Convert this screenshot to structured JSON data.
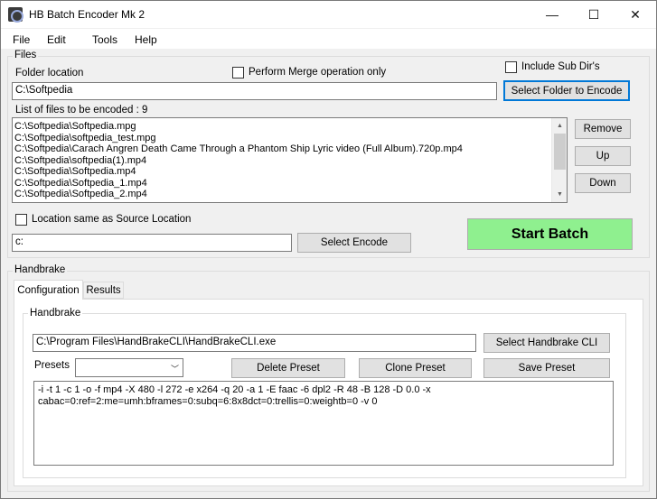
{
  "window": {
    "title": "HB Batch Encoder Mk 2",
    "controls": {
      "minimize": "—",
      "maximize": "☐",
      "close": "✕"
    }
  },
  "menu": [
    "File",
    "Edit",
    "Tools",
    "Help"
  ],
  "files": {
    "group_label": "Files",
    "folder_location_label": "Folder location",
    "merge_label": "Perform Merge operation only",
    "merge_checked": false,
    "include_subdirs_label": "Include Sub Dir's",
    "include_subdirs_checked": false,
    "folder_value": "C:\\Softpedia",
    "select_folder_button": "Select Folder to Encode",
    "list_label": "List of files to be encoded :  9",
    "list_items": [
      "C:\\Softpedia\\Softpedia.mpg",
      "C:\\Softpedia\\softpedia_test.mpg",
      "C:\\Softpedia\\Carach Angren  Death Came Through a Phantom Ship  Lyric video (Full Album).720p.mp4",
      "C:\\Softpedia\\softpedia(1).mp4",
      "C:\\Softpedia\\Softpedia.mp4",
      "C:\\Softpedia\\Softpedia_1.mp4",
      "C:\\Softpedia\\Softpedia_2.mp4"
    ],
    "remove_button": "Remove",
    "up_button": "Up",
    "down_button": "Down",
    "same_location_label": "Location same as Source Location",
    "same_location_checked": false,
    "encode_location_value": "c:",
    "select_encode_button": "Select Encode",
    "start_batch_button": "Start Batch",
    "start_batch_color": "#8ff08f"
  },
  "handbrake": {
    "group_label": "Handbrake",
    "tabs": [
      "Configuration",
      "Results"
    ],
    "inner_group_label": "Handbrake",
    "cli_path": "C:\\Program Files\\HandBrakeCLI\\HandBrakeCLI.exe",
    "select_cli_button": "Select Handbrake CLI",
    "presets_label": "Presets",
    "preset_value": "",
    "delete_preset_button": "Delete Preset",
    "clone_preset_button": "Clone Preset",
    "save_preset_button": "Save Preset",
    "arguments": "-i -t 1 -c 1 -o -f mp4 -X 480 -l 272 -e x264 -q 20 -a 1 -E faac -6 dpl2 -R 48 -B 128 -D 0.0 -x\ncabac=0:ref=2:me=umh:bframes=0:subq=6:8x8dct=0:trellis=0:weightb=0 -v 0"
  }
}
